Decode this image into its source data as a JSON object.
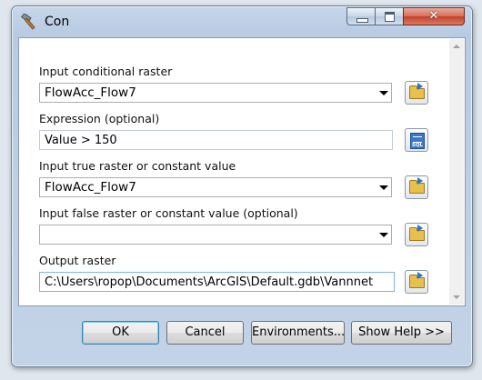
{
  "window": {
    "title": "Con",
    "icon": "hammer-icon",
    "controls": [
      "minimize",
      "maximize",
      "close"
    ]
  },
  "form": {
    "input_conditional_raster": {
      "label": "Input conditional raster",
      "value": "FlowAcc_Flow7"
    },
    "expression": {
      "label": "Expression (optional)",
      "value": "Value > 150"
    },
    "input_true": {
      "label": "Input true raster or constant value",
      "value": "FlowAcc_Flow7"
    },
    "input_false": {
      "label": "Input false raster or constant value (optional)",
      "value": ""
    },
    "output_raster": {
      "label": "Output raster",
      "value": "C:\\Users\\ropop\\Documents\\ArcGIS\\Default.gdb\\Vannnet"
    }
  },
  "icons": {
    "sql": "SQL"
  },
  "buttons": {
    "ok": "OK",
    "cancel": "Cancel",
    "environments": "Environments...",
    "show_help": "Show Help >>"
  }
}
